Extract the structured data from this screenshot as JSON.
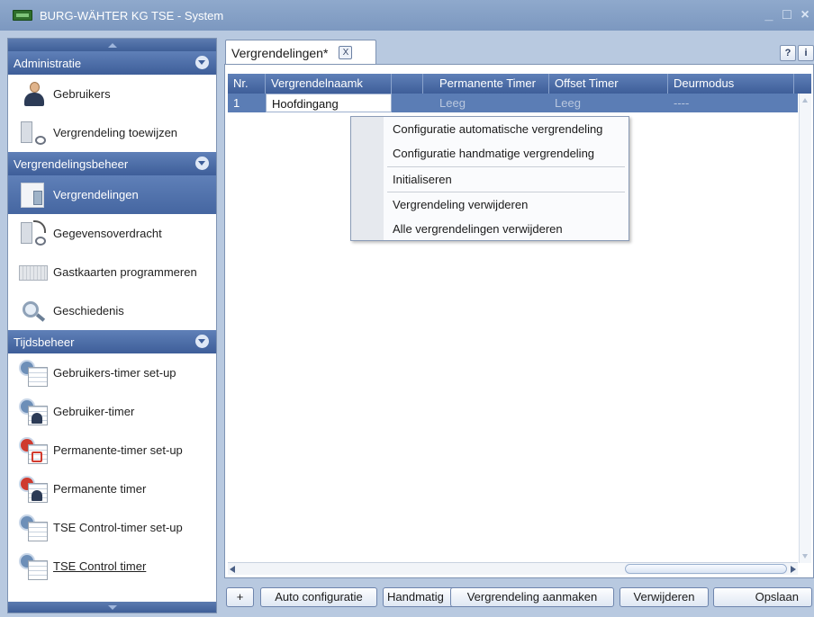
{
  "window": {
    "title": "BURG-WÄHTER KG TSE - System",
    "controls": [
      "_",
      "□",
      "×"
    ]
  },
  "sidebar": {
    "sections": [
      {
        "title": "Administratie",
        "items": [
          {
            "label": "Gebruikers",
            "icon": "user-icon"
          },
          {
            "label": "Vergrendeling toewijzen",
            "icon": "assign-lock-icon"
          }
        ]
      },
      {
        "title": "Vergrendelingsbeheer",
        "items": [
          {
            "label": "Vergrendelingen",
            "icon": "lock-device-icon",
            "active": true
          },
          {
            "label": "Gegevensoverdracht",
            "icon": "data-transfer-icon"
          },
          {
            "label": "Gastkaarten programmeren",
            "icon": "card-programmer-icon"
          },
          {
            "label": "Geschiedenis",
            "icon": "history-icon"
          }
        ]
      },
      {
        "title": "Tijdsbeheer",
        "items": [
          {
            "label": "Gebruikers-timer set-up",
            "icon": "timer-setup-icon"
          },
          {
            "label": "Gebruiker-timer",
            "icon": "user-timer-icon"
          },
          {
            "label": "Permanente-timer set-up",
            "icon": "permanent-timer-setup-icon"
          },
          {
            "label": "Permanente timer",
            "icon": "permanent-timer-icon"
          },
          {
            "label": "TSE Control-timer set-up",
            "icon": "control-timer-setup-icon"
          },
          {
            "label": "TSE Control timer",
            "icon": "control-timer-icon"
          }
        ]
      }
    ]
  },
  "tab": {
    "label": "Vergrendelingen*",
    "close": "X"
  },
  "help": {
    "help_label": "?",
    "info_label": "i"
  },
  "grid": {
    "columns": [
      "Nr.",
      "Vergrendelnaamk",
      "",
      "Permanente Timer",
      "Offset Timer",
      "Deurmodus"
    ],
    "rows": [
      {
        "nr": "1",
        "name": "Hoofdingang",
        "extra": "",
        "permanent_timer": "Leeg",
        "offset_timer": "Leeg",
        "deurmodus": "----"
      }
    ]
  },
  "context_menu": {
    "items": [
      "Configuratie automatische vergrendeling",
      "Configuratie handmatige vergrendeling",
      "Initialiseren",
      "Vergrendeling verwijderen",
      "Alle vergrendelingen verwijderen"
    ]
  },
  "toolbar": {
    "add_label": "+",
    "auto_config_label": "Auto configuratie",
    "manual_label": "Handmatig",
    "create_label": "Vergrendeling aanmaken",
    "delete_label": "Verwijderen",
    "save_label": "Opslaan"
  },
  "colors": {
    "header_blue": "#4a6ba6",
    "selected_row": "#5b7db5",
    "window_bg": "#b8c9e0"
  }
}
